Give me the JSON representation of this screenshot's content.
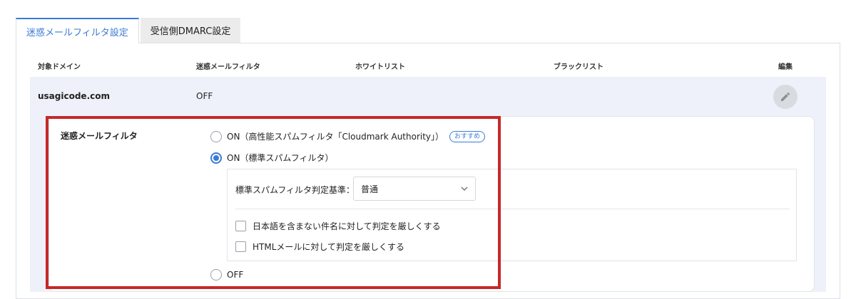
{
  "tabs": [
    {
      "label": "迷惑メールフィルタ設定",
      "active": true
    },
    {
      "label": "受信側DMARC設定",
      "active": false
    }
  ],
  "table": {
    "headers": {
      "domain": "対象ドメイン",
      "spam_filter": "迷惑メールフィルタ",
      "whitelist": "ホワイトリスト",
      "blacklist": "ブラックリスト",
      "edit": "編集"
    },
    "row": {
      "domain": "usagicode.com",
      "spam_filter": "OFF",
      "edit_icon": "pencil-icon"
    }
  },
  "settings": {
    "section_label": "迷惑メールフィルタ",
    "options": {
      "cloudmark": "ON（高性能スパムフィルタ「Cloudmark Authority」）",
      "cloudmark_badge": "おすすめ",
      "standard": "ON（標準スパムフィルタ）",
      "off": "OFF"
    },
    "selected_option": "standard",
    "criteria_label": "標準スパムフィルタ判定基準：",
    "criteria_value": "普通",
    "checkboxes": [
      {
        "label": "日本語を含まない件名に対して判定を厳しくする",
        "checked": false
      },
      {
        "label": "HTMLメールに対して判定を厳しくする",
        "checked": false
      }
    ]
  },
  "colors": {
    "accent": "#3a7bd5",
    "highlight_border": "#c62828",
    "row_background": "#eef1f9"
  }
}
